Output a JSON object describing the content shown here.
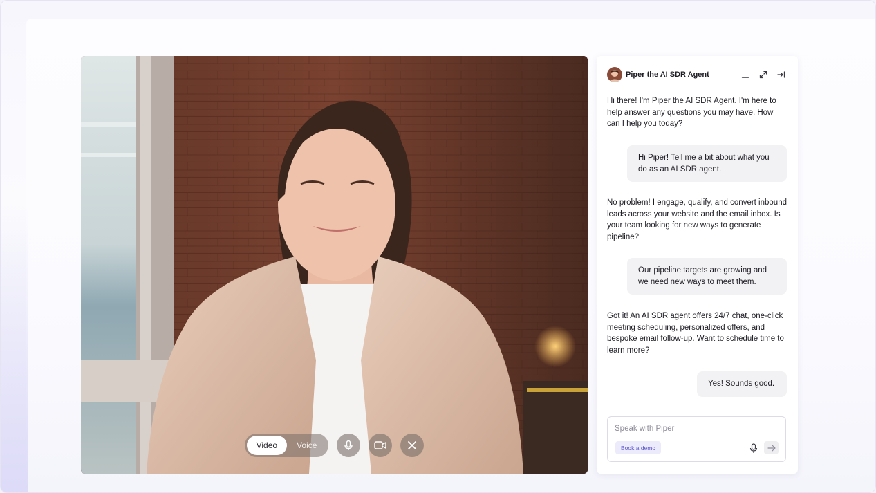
{
  "video": {
    "mode_options": [
      "Video",
      "Voice"
    ],
    "active_mode": "Video",
    "icons": {
      "mic": "microphone-icon",
      "camera": "camera-icon",
      "end": "close-icon"
    }
  },
  "chat": {
    "agent_name": "Piper the AI SDR Agent",
    "header_icons": [
      "minimize-icon",
      "expand-icon",
      "collapse-panel-icon"
    ],
    "messages": [
      {
        "role": "agent",
        "text": "Hi there! I'm Piper the AI SDR Agent. I'm here to help answer any questions you may have. How can I help you today?"
      },
      {
        "role": "user",
        "text": "Hi Piper! Tell me a bit about what you do as an AI SDR agent."
      },
      {
        "role": "agent",
        "text": "No problem! I engage, qualify, and convert inbound leads across your website and the email inbox. Is your team looking for new ways to generate pipeline?"
      },
      {
        "role": "user",
        "text": "Our pipeline targets are growing and we need new ways to meet them."
      },
      {
        "role": "agent",
        "text": "Got it! An AI SDR agent offers 24/7 chat, one-click meeting scheduling, personalized offers, and bespoke email follow-up. Want to schedule time to learn more?"
      },
      {
        "role": "user",
        "text": "Yes! Sounds good."
      }
    ],
    "input": {
      "placeholder": "Speak with Piper",
      "value": ""
    },
    "demo_chip": "Book a demo",
    "accent_color": "#5b55c9"
  }
}
